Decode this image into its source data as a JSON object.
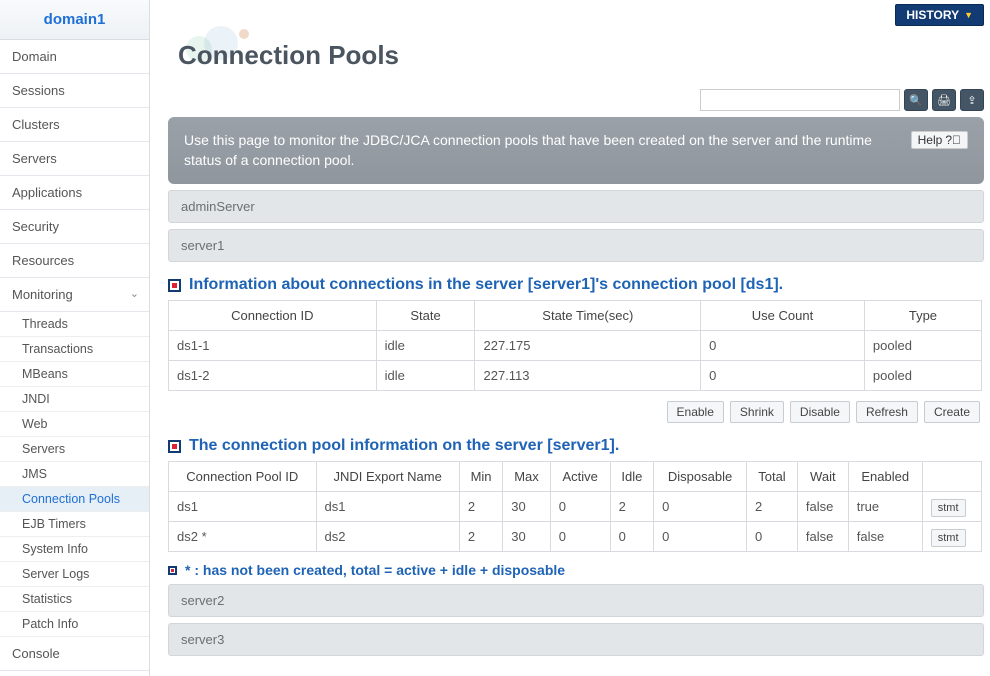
{
  "sidebar": {
    "title": "domain1",
    "items": [
      {
        "label": "Domain"
      },
      {
        "label": "Sessions"
      },
      {
        "label": "Clusters"
      },
      {
        "label": "Servers"
      },
      {
        "label": "Applications"
      },
      {
        "label": "Security"
      },
      {
        "label": "Resources"
      },
      {
        "label": "Monitoring",
        "expand": "⌄",
        "sub": [
          {
            "label": "Threads"
          },
          {
            "label": "Transactions"
          },
          {
            "label": "MBeans"
          },
          {
            "label": "JNDI"
          },
          {
            "label": "Web"
          },
          {
            "label": "Servers"
          },
          {
            "label": "JMS"
          },
          {
            "label": "Connection Pools",
            "active": true
          },
          {
            "label": "EJB Timers"
          },
          {
            "label": "System Info"
          },
          {
            "label": "Server Logs"
          },
          {
            "label": "Statistics"
          },
          {
            "label": "Patch Info"
          }
        ]
      },
      {
        "label": "Console"
      }
    ]
  },
  "actions": {
    "history": "HISTORY",
    "help": "Help",
    "enable": "Enable",
    "shrink": "Shrink",
    "disable": "Disable",
    "refresh": "Refresh",
    "create": "Create",
    "stmt": "stmt"
  },
  "page": {
    "title": "Connection Pools",
    "banner": "Use this page to monitor the JDBC/JCA connection pools that have been created on the server and the runtime status of a connection pool.",
    "server_rows": [
      "adminServer",
      "server1"
    ],
    "bottom_rows": [
      "server2",
      "server3"
    ]
  },
  "section1": {
    "title": "Information about connections in the server [server1]'s connection pool [ds1].",
    "cols": [
      "Connection ID",
      "State",
      "State Time(sec)",
      "Use Count",
      "Type"
    ],
    "rows": [
      {
        "id": "ds1-1",
        "state": "idle",
        "time": "227.175",
        "use": "0",
        "type": "pooled"
      },
      {
        "id": "ds1-2",
        "state": "idle",
        "time": "227.113",
        "use": "0",
        "type": "pooled"
      }
    ]
  },
  "section2": {
    "title": "The connection pool information on the server [server1].",
    "cols": [
      "Connection Pool ID",
      "JNDI Export Name",
      "Min",
      "Max",
      "Active",
      "Idle",
      "Disposable",
      "Total",
      "Wait",
      "Enabled",
      ""
    ],
    "rows": [
      {
        "id": "ds1",
        "jndi": "ds1",
        "min": "2",
        "max": "30",
        "active": "0",
        "idle": "2",
        "disp": "0",
        "total": "2",
        "wait": "false",
        "enabled": "true"
      },
      {
        "id": "ds2 *",
        "jndi": "ds2",
        "min": "2",
        "max": "30",
        "active": "0",
        "idle": "0",
        "disp": "0",
        "total": "0",
        "wait": "false",
        "enabled": "false"
      }
    ]
  },
  "note": "* : has not been created, total = active + idle + disposable"
}
